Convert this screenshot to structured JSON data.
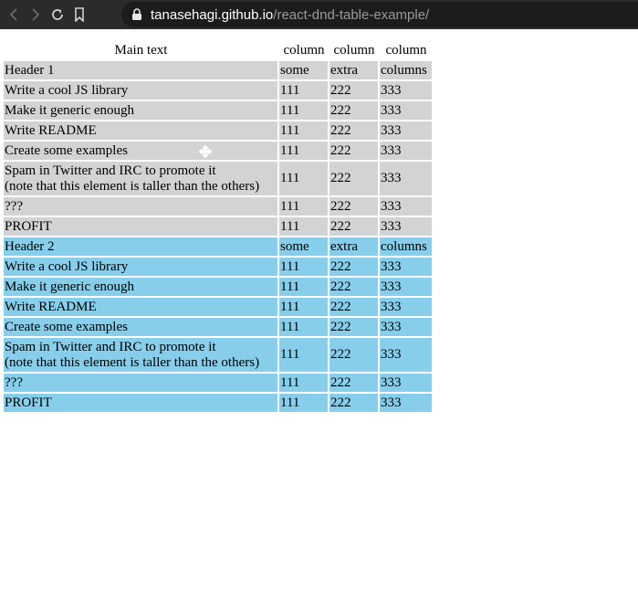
{
  "browser": {
    "url_host": "tanasehagi.github.io",
    "url_path": "/react-dnd-table-example/"
  },
  "table": {
    "columns": [
      "Main text",
      "column",
      "column",
      "column"
    ],
    "groups": [
      {
        "name": "group-1",
        "color": "#d3d3d3",
        "header": [
          "Header 1",
          "some",
          "extra",
          "columns"
        ],
        "rows": [
          {
            "text": [
              "Write a cool JS library"
            ],
            "a": "111",
            "b": "222",
            "c": "333"
          },
          {
            "text": [
              "Make it generic enough"
            ],
            "a": "111",
            "b": "222",
            "c": "333"
          },
          {
            "text": [
              "Write README"
            ],
            "a": "111",
            "b": "222",
            "c": "333"
          },
          {
            "text": [
              "Create some examples"
            ],
            "a": "111",
            "b": "222",
            "c": "333"
          },
          {
            "text": [
              "Spam in Twitter and IRC to promote it",
              "(note that this element is taller than the others)"
            ],
            "a": "111",
            "b": "222",
            "c": "333"
          },
          {
            "text": [
              "???"
            ],
            "a": "111",
            "b": "222",
            "c": "333"
          },
          {
            "text": [
              "PROFIT"
            ],
            "a": "111",
            "b": "222",
            "c": "333"
          }
        ]
      },
      {
        "name": "group-2",
        "color": "#87ceeb",
        "header": [
          "Header 2",
          "some",
          "extra",
          "columns"
        ],
        "rows": [
          {
            "text": [
              "Write a cool JS library"
            ],
            "a": "111",
            "b": "222",
            "c": "333"
          },
          {
            "text": [
              "Make it generic enough"
            ],
            "a": "111",
            "b": "222",
            "c": "333"
          },
          {
            "text": [
              "Write README"
            ],
            "a": "111",
            "b": "222",
            "c": "333"
          },
          {
            "text": [
              "Create some examples"
            ],
            "a": "111",
            "b": "222",
            "c": "333"
          },
          {
            "text": [
              "Spam in Twitter and IRC to promote it",
              "(note that this element is taller than the others)"
            ],
            "a": "111",
            "b": "222",
            "c": "333"
          },
          {
            "text": [
              "???"
            ],
            "a": "111",
            "b": "222",
            "c": "333"
          },
          {
            "text": [
              "PROFIT"
            ],
            "a": "111",
            "b": "222",
            "c": "333"
          }
        ]
      }
    ]
  },
  "icons": {
    "back": "back-arrow-icon",
    "forward": "forward-arrow-icon",
    "reload": "reload-icon",
    "bookmark": "bookmark-icon",
    "lock": "lock-icon",
    "drag": "drag-move-icon"
  }
}
